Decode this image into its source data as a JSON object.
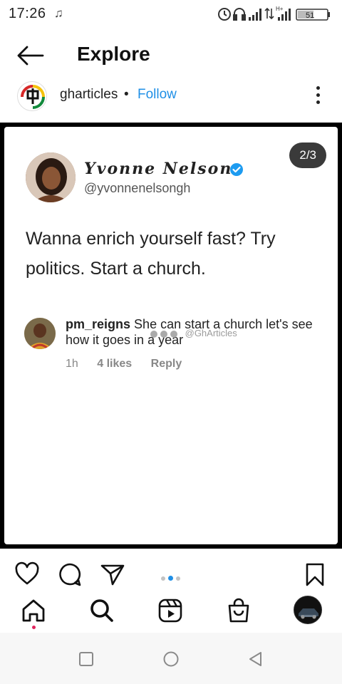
{
  "status_bar": {
    "time": "17:26",
    "music_glyph": "♫",
    "battery_level": "51",
    "icons": [
      "alarm-icon",
      "headphones-icon",
      "signal-icon",
      "data-arrows-icon",
      "hplus-signal-icon",
      "battery-icon"
    ]
  },
  "header": {
    "title": "Explore",
    "back_icon": "arrow-left-icon"
  },
  "post": {
    "author": "gharticles",
    "separator": "•",
    "follow_label": "Follow",
    "more_icon": "more-vertical-icon"
  },
  "tweet": {
    "page_indicator": "2/3",
    "name": "Yvonne Nelson",
    "handle": "@yvonnenelsongh",
    "text": "Wanna enrich yourself fast? Try politics. Start a church.",
    "verified_color": "#1d9bf0"
  },
  "comment": {
    "user": "pm_reigns",
    "text": "She can start a church let's see how it goes in a year",
    "watermark": "@GhArticles",
    "time": "1h",
    "likes": "4 likes",
    "reply_label": "Reply"
  },
  "actions": {
    "icons": [
      "heart-icon",
      "comment-icon",
      "share-icon",
      "bookmark-icon"
    ],
    "carousel_total": 3,
    "carousel_active": 2
  },
  "bottom_nav": {
    "icons": [
      "home-icon",
      "search-icon",
      "reels-icon",
      "shop-icon",
      "profile-avatar"
    ]
  },
  "system_nav": {
    "icons": [
      "recent-apps-icon",
      "home-circle-icon",
      "back-triangle-icon"
    ]
  },
  "colors": {
    "accent": "#1f8fe6",
    "notification_dot": "#e0245e"
  }
}
